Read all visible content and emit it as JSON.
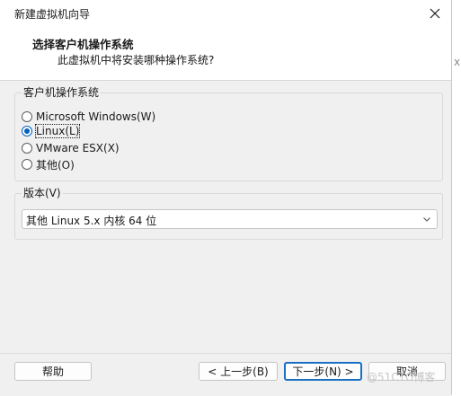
{
  "window": {
    "title": "新建虚拟机向导",
    "close_icon": "close-icon"
  },
  "header": {
    "title": "选择客户机操作系统",
    "subtitle": "此虚拟机中将安装哪种操作系统?"
  },
  "os_group": {
    "legend": "客户机操作系统",
    "options": [
      {
        "label": "Microsoft Windows(W)",
        "checked": false
      },
      {
        "label": "Linux(L)",
        "checked": true
      },
      {
        "label": "VMware ESX(X)",
        "checked": false
      },
      {
        "label": "其他(O)",
        "checked": false
      }
    ]
  },
  "version_group": {
    "legend": "版本(V)",
    "selected": "其他 Linux 5.x 内核 64 位"
  },
  "footer": {
    "help": "帮助",
    "back": "< 上一步(B)",
    "next": "下一步(N) >",
    "cancel": "取消"
  },
  "watermark": "@51CTO博客",
  "edge_text": "x"
}
